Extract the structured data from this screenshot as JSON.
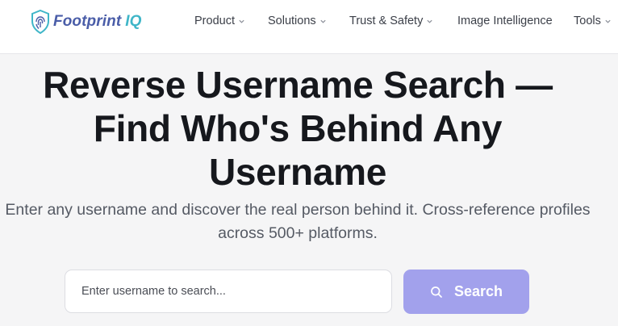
{
  "brand": {
    "name": "Footprint",
    "suffix": "IQ"
  },
  "nav": {
    "items": [
      {
        "label": "Product",
        "has_dropdown": true
      },
      {
        "label": "Solutions",
        "has_dropdown": true
      },
      {
        "label": "Trust & Safety",
        "has_dropdown": true
      },
      {
        "label": "Image Intelligence",
        "has_dropdown": false
      },
      {
        "label": "Tools",
        "has_dropdown": true
      }
    ]
  },
  "hero": {
    "title": "Reverse Username Search — Find Who's Behind Any Username",
    "subtitle": "Enter any username and discover the real person behind it. Cross-reference profiles across 500+ platforms."
  },
  "search": {
    "placeholder": "Enter username to search...",
    "value": "",
    "button_label": "Search",
    "button_icon": "search-icon"
  },
  "colors": {
    "brand_primary": "#4a5da8",
    "brand_accent": "#3fb6c8",
    "button_bg": "#a2a1ec",
    "page_bg": "#f5f5f6"
  }
}
